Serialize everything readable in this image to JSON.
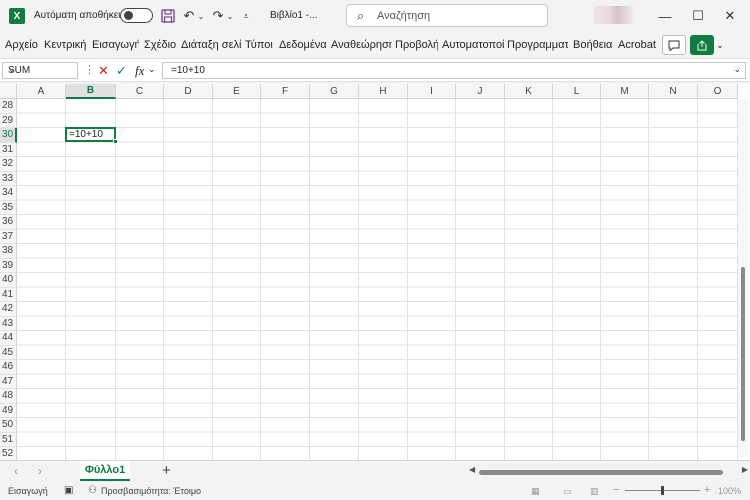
{
  "titlebar": {
    "logo": "X",
    "autosave_label": "Αυτόματη αποθήκευση",
    "doc_title": "Βιβλίο1  -...",
    "search_placeholder": "Αναζήτηση",
    "icons": [
      "excel-logo",
      "save-icon",
      "undo-icon",
      "redo-icon",
      "customize-icon",
      "search-icon",
      "minimize-icon",
      "maximize-icon",
      "close-icon"
    ]
  },
  "ribbon": {
    "tabs": [
      "Αρχείο",
      "Κεντρική",
      "Εισαγωγή",
      "Σχέδιο",
      "Διάταξη σελίδας",
      "Τύποι",
      "Δεδομένα",
      "Αναθεώρηση",
      "Προβολή",
      "Αυτοματοποίηση",
      "Προγραμματιστής",
      "Βοήθεια",
      "Acrobat"
    ]
  },
  "formula_bar": {
    "name_box": "SUM",
    "formula": "=10+10",
    "fx_label": "fx"
  },
  "grid": {
    "columns": [
      "A",
      "B",
      "C",
      "D",
      "E",
      "F",
      "G",
      "H",
      "I",
      "J",
      "K",
      "L",
      "M",
      "N",
      "O"
    ],
    "selected_column": "B",
    "rows": [
      "28",
      "29",
      "30",
      "31",
      "32",
      "33",
      "34",
      "35",
      "36",
      "37",
      "38",
      "39",
      "40",
      "41",
      "42",
      "43",
      "44",
      "45",
      "46",
      "47",
      "48",
      "49",
      "50",
      "51",
      "52"
    ],
    "selected_row": "30",
    "active_cell_value": "=10+10"
  },
  "sheets": {
    "tabs": [
      "Φύλλο1"
    ],
    "add_label": "+"
  },
  "status": {
    "mode": "Εισαγωγή",
    "accessibility": "Προσβασιμότητα: Έτοιμο",
    "zoom": "100%"
  },
  "colors": {
    "accent": "#107c41"
  }
}
